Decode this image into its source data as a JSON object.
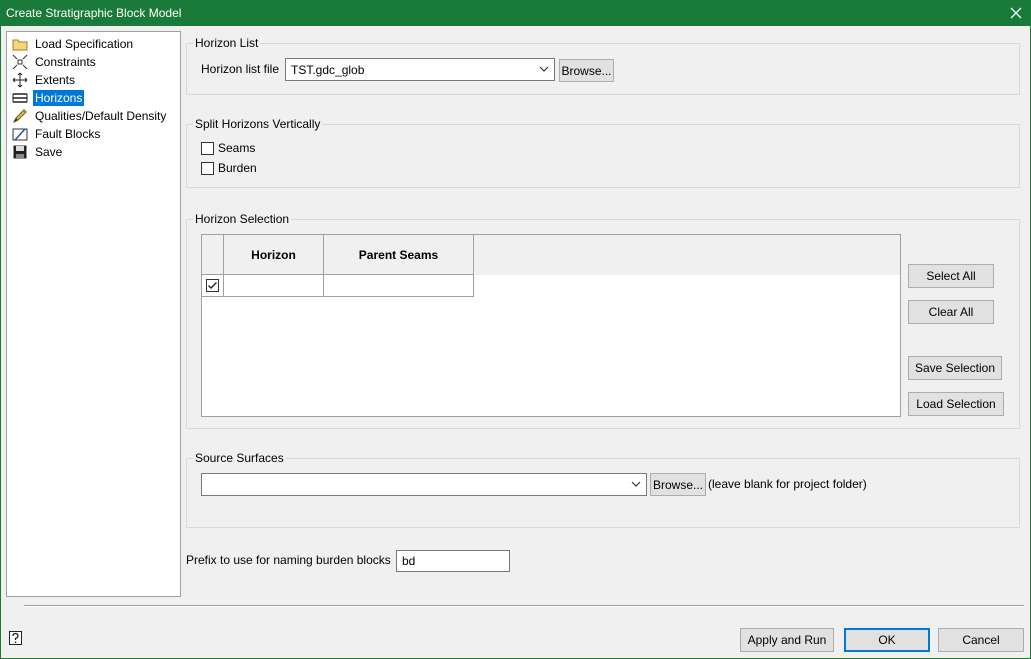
{
  "window": {
    "title": "Create Stratigraphic Block Model"
  },
  "tree": {
    "items": [
      {
        "label": "Load Specification",
        "icon": "folder-icon"
      },
      {
        "label": "Constraints",
        "icon": "constraints-icon"
      },
      {
        "label": "Extents",
        "icon": "move-arrows-icon"
      },
      {
        "label": "Horizons",
        "icon": "layers-icon",
        "selected": true
      },
      {
        "label": "Qualities/Default Density",
        "icon": "pencil-icon"
      },
      {
        "label": "Fault Blocks",
        "icon": "fault-icon"
      },
      {
        "label": "Save",
        "icon": "floppy-disk-icon"
      }
    ]
  },
  "horizon_list": {
    "title": "Horizon List",
    "file_label": "Horizon list file",
    "file_value": "TST.gdc_glob",
    "browse_label": "Browse..."
  },
  "split": {
    "title": "Split Horizons Vertically",
    "seams_label": "Seams",
    "burden_label": "Burden"
  },
  "selection": {
    "title": "Horizon Selection",
    "columns": [
      "Horizon",
      "Parent Seams"
    ],
    "rows": [
      {
        "checked": true,
        "horizon": "",
        "parent_seams": ""
      }
    ],
    "select_all": "Select All",
    "clear_all": "Clear All",
    "save_selection": "Save Selection",
    "load_selection": "Load Selection"
  },
  "source": {
    "title": "Source Surfaces",
    "value": "",
    "browse_label": "Browse...",
    "hint": "(leave blank for project folder)"
  },
  "prefix": {
    "label": "Prefix to use for naming burden blocks",
    "value": "bd"
  },
  "footer": {
    "apply_run": "Apply and Run",
    "ok": "OK",
    "cancel": "Cancel"
  },
  "colors": {
    "titlebar": "#1a7a3a",
    "selection": "#0078d7"
  }
}
